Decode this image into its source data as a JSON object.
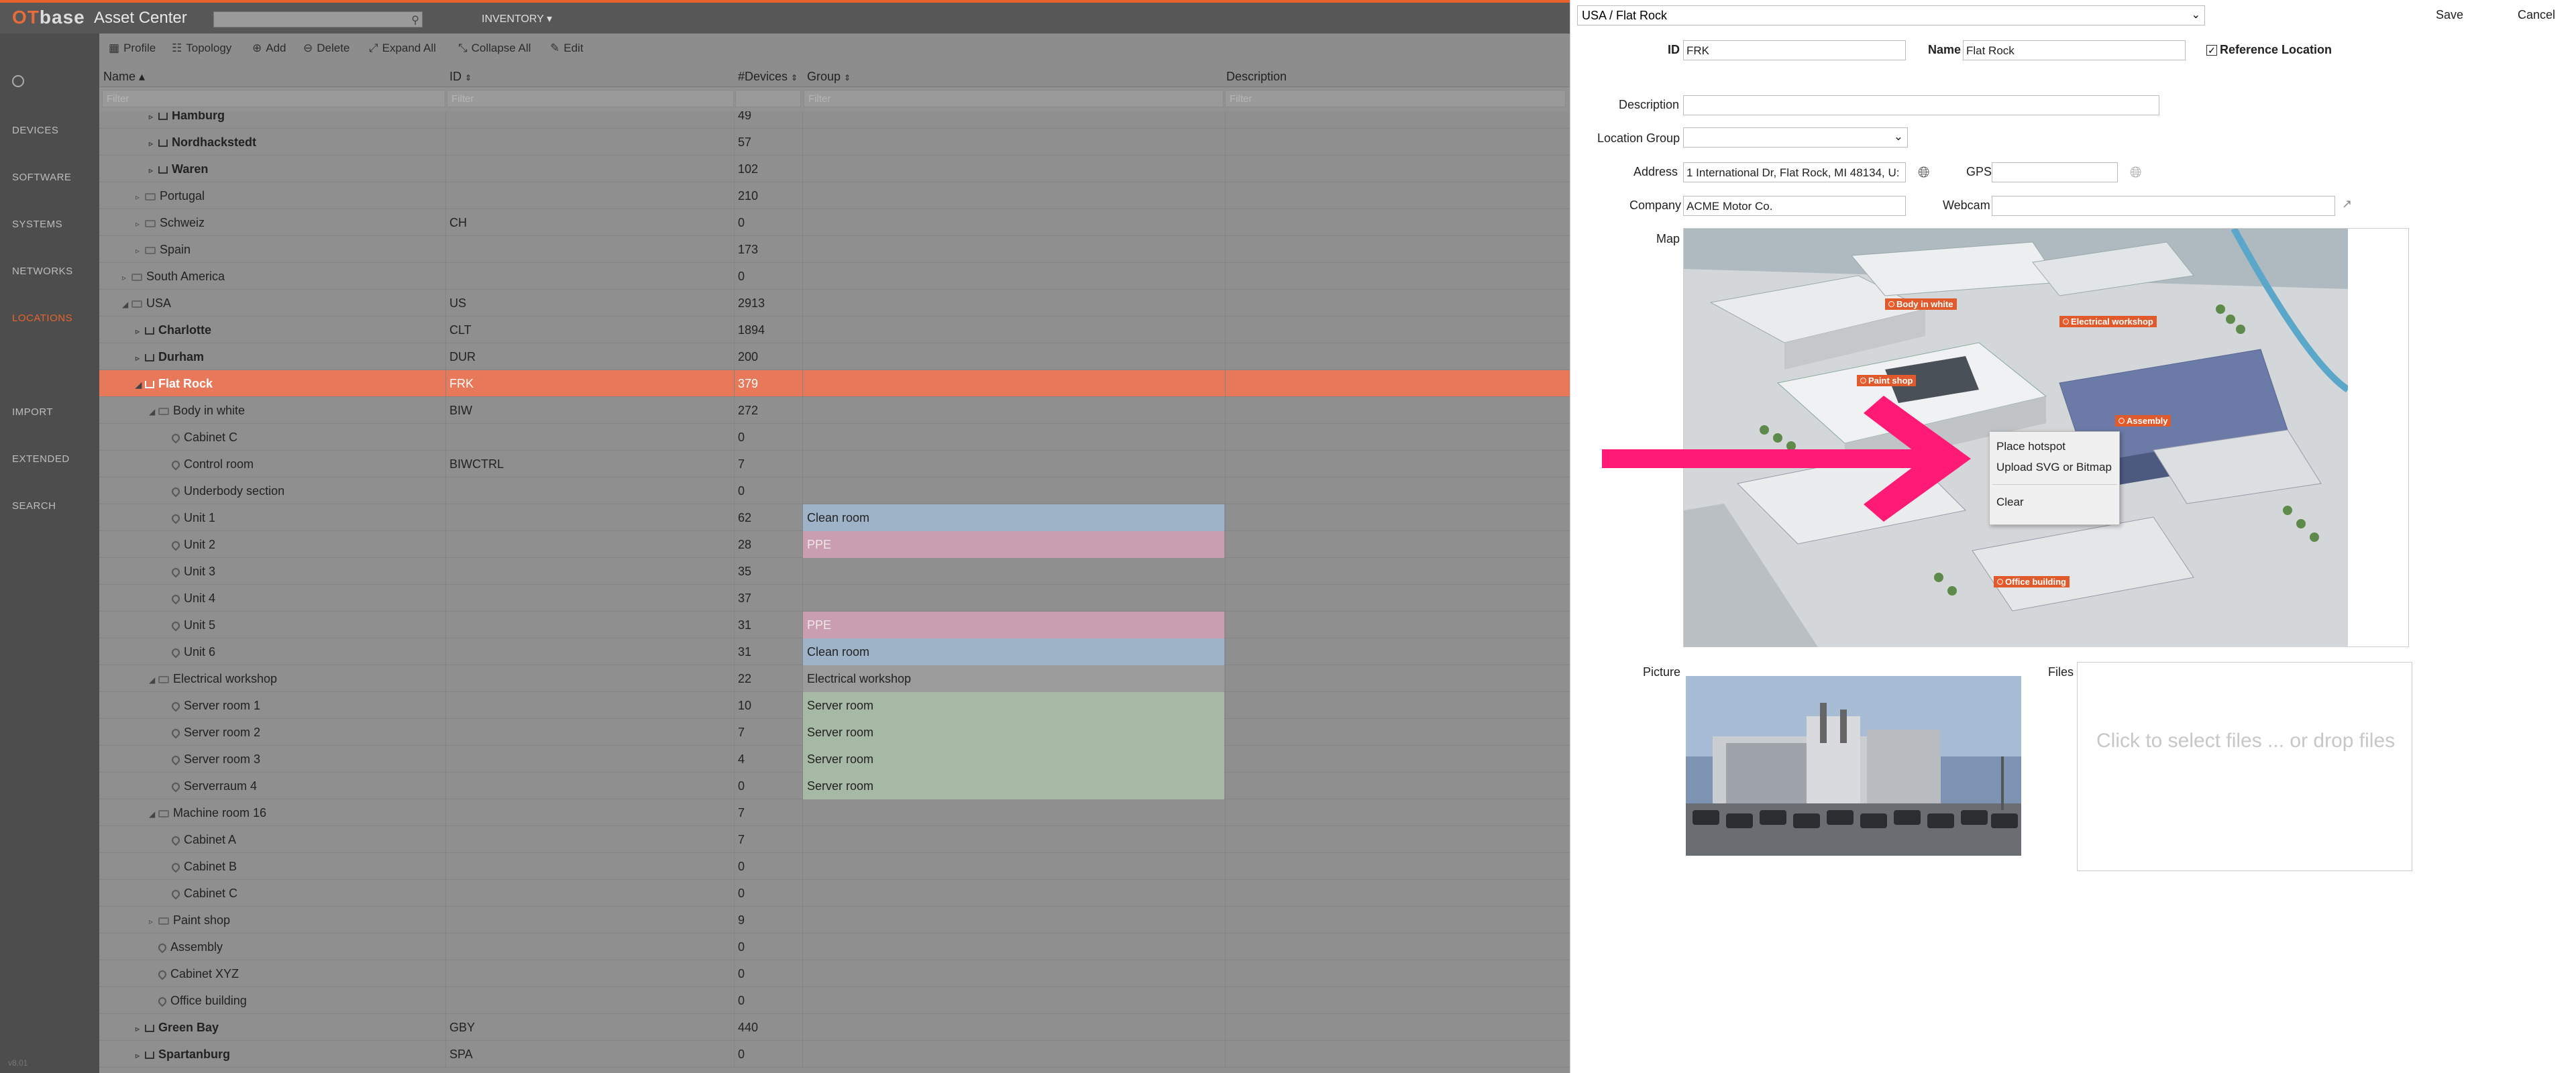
{
  "app": {
    "logo_a": "OT",
    "logo_b": "base",
    "name": "Asset Center",
    "inventory_menu": "INVENTORY",
    "version": "v8.01"
  },
  "nav": [
    "DEVICES",
    "SOFTWARE",
    "SYSTEMS",
    "NETWORKS",
    "LOCATIONS",
    "IMPORT",
    "EXTENDED",
    "SEARCH"
  ],
  "nav_active": "LOCATIONS",
  "toolbar": [
    "Profile",
    "Topology",
    "Add",
    "Delete",
    "Expand All",
    "Collapse All",
    "Edit"
  ],
  "columns": {
    "name": "Name",
    "id": "ID",
    "devices": "#Devices",
    "group": "Group",
    "description": "Description",
    "filter": "Filter"
  },
  "rows": [
    {
      "name": "Hamburg",
      "id": "",
      "devices": "49",
      "group": "",
      "indent": 2,
      "type": "home",
      "bold": true
    },
    {
      "name": "Nordhackstedt",
      "id": "",
      "devices": "57",
      "group": "",
      "indent": 2,
      "type": "home",
      "bold": true
    },
    {
      "name": "Waren",
      "id": "",
      "devices": "102",
      "group": "",
      "indent": 2,
      "type": "home",
      "bold": true
    },
    {
      "name": "Portugal",
      "id": "",
      "devices": "210",
      "group": "",
      "indent": 1,
      "type": "folder"
    },
    {
      "name": "Schweiz",
      "id": "CH",
      "devices": "0",
      "group": "",
      "indent": 1,
      "type": "folder"
    },
    {
      "name": "Spain",
      "id": "",
      "devices": "173",
      "group": "",
      "indent": 1,
      "type": "folder"
    },
    {
      "name": "South America",
      "id": "",
      "devices": "0",
      "group": "",
      "indent": 0,
      "type": "folder"
    },
    {
      "name": "USA",
      "id": "US",
      "devices": "2913",
      "group": "",
      "indent": 0,
      "type": "folder",
      "open": true
    },
    {
      "name": "Charlotte",
      "id": "CLT",
      "devices": "1894",
      "group": "",
      "indent": 1,
      "type": "home",
      "bold": true
    },
    {
      "name": "Durham",
      "id": "DUR",
      "devices": "200",
      "group": "",
      "indent": 1,
      "type": "home",
      "bold": true
    },
    {
      "name": "Flat Rock",
      "id": "FRK",
      "devices": "379",
      "group": "",
      "indent": 1,
      "type": "home",
      "bold": true,
      "selected": true,
      "open": true
    },
    {
      "name": "Body in white",
      "id": "BIW",
      "devices": "272",
      "group": "",
      "indent": 2,
      "type": "folder",
      "open": true
    },
    {
      "name": "Cabinet C",
      "id": "",
      "devices": "0",
      "group": "",
      "indent": 3,
      "type": "pin"
    },
    {
      "name": "Control room",
      "id": "BIWCTRL",
      "devices": "7",
      "group": "",
      "indent": 3,
      "type": "pin"
    },
    {
      "name": "Underbody section",
      "id": "",
      "devices": "0",
      "group": "",
      "indent": 3,
      "type": "pin"
    },
    {
      "name": "Unit 1",
      "id": "",
      "devices": "62",
      "group": "Clean room",
      "gcolor": "#9fb3c8",
      "indent": 3,
      "type": "pin"
    },
    {
      "name": "Unit 2",
      "id": "",
      "devices": "28",
      "group": "PPE",
      "gcolor": "#c99fb0",
      "gtext": "#f0e6ea",
      "indent": 3,
      "type": "pin"
    },
    {
      "name": "Unit 3",
      "id": "",
      "devices": "35",
      "group": "",
      "indent": 3,
      "type": "pin"
    },
    {
      "name": "Unit 4",
      "id": "",
      "devices": "37",
      "group": "",
      "indent": 3,
      "type": "pin"
    },
    {
      "name": "Unit 5",
      "id": "",
      "devices": "31",
      "group": "PPE",
      "gcolor": "#c99fb0",
      "gtext": "#f0e6ea",
      "indent": 3,
      "type": "pin"
    },
    {
      "name": "Unit 6",
      "id": "",
      "devices": "31",
      "group": "Clean room",
      "gcolor": "#9fb3c8",
      "indent": 3,
      "type": "pin"
    },
    {
      "name": "Electrical workshop",
      "id": "",
      "devices": "22",
      "group": "Electrical workshop",
      "gcolor": "#9b9b9b",
      "indent": 2,
      "type": "folder",
      "open": true
    },
    {
      "name": "Server room 1",
      "id": "",
      "devices": "10",
      "group": "Server room",
      "gcolor": "#a6b9a4",
      "indent": 3,
      "type": "pin"
    },
    {
      "name": "Server room 2",
      "id": "",
      "devices": "7",
      "group": "Server room",
      "gcolor": "#a6b9a4",
      "indent": 3,
      "type": "pin"
    },
    {
      "name": "Server room 3",
      "id": "",
      "devices": "4",
      "group": "Server room",
      "gcolor": "#a6b9a4",
      "indent": 3,
      "type": "pin"
    },
    {
      "name": "Serverraum 4",
      "id": "",
      "devices": "0",
      "group": "Server room",
      "gcolor": "#a6b9a4",
      "indent": 3,
      "type": "pin"
    },
    {
      "name": "Machine room 16",
      "id": "",
      "devices": "7",
      "group": "",
      "indent": 2,
      "type": "folder",
      "open": true
    },
    {
      "name": "Cabinet A",
      "id": "",
      "devices": "7",
      "group": "",
      "indent": 3,
      "type": "pin"
    },
    {
      "name": "Cabinet B",
      "id": "",
      "devices": "0",
      "group": "",
      "indent": 3,
      "type": "pin"
    },
    {
      "name": "Cabinet C",
      "id": "",
      "devices": "0",
      "group": "",
      "indent": 3,
      "type": "pin"
    },
    {
      "name": "Paint shop",
      "id": "",
      "devices": "9",
      "group": "",
      "indent": 2,
      "type": "folder"
    },
    {
      "name": "Assembly",
      "id": "",
      "devices": "0",
      "group": "",
      "indent": 2,
      "type": "pin"
    },
    {
      "name": "Cabinet XYZ",
      "id": "",
      "devices": "0",
      "group": "",
      "indent": 2,
      "type": "pin"
    },
    {
      "name": "Office building",
      "id": "",
      "devices": "0",
      "group": "",
      "indent": 2,
      "type": "pin"
    },
    {
      "name": "Green Bay",
      "id": "GBY",
      "devices": "440",
      "group": "",
      "indent": 1,
      "type": "home",
      "bold": true
    },
    {
      "name": "Spartanburg",
      "id": "SPA",
      "devices": "0",
      "group": "",
      "indent": 1,
      "type": "home",
      "bold": true
    }
  ],
  "panel": {
    "path": "USA / Flat Rock",
    "save": "Save",
    "cancel": "Cancel",
    "id_label": "ID",
    "id_value": "FRK",
    "name_label": "Name",
    "name_value": "Flat Rock",
    "reference_label": "Reference Location",
    "description_label": "Description",
    "description_value": "",
    "location_group_label": "Location Group",
    "address_label": "Address",
    "address_value": "1 International Dr, Flat Rock, MI 48134, U:",
    "gps_label": "GPS",
    "gps_value": "",
    "company_label": "Company",
    "company_value": "ACME Motor Co.",
    "webcam_label": "Webcam",
    "webcam_value": "",
    "map_label": "Map",
    "picture_label": "Picture",
    "files_label": "Files",
    "files_placeholder": "Click to select files ... or drop files",
    "hotspots": [
      "Body in white",
      "Electrical workshop",
      "Paint shop",
      "Assembly",
      "Office building"
    ],
    "context_menu": [
      "Place hotspot",
      "Upload SVG or Bitmap",
      "Clear"
    ]
  },
  "colors": {
    "accent": "#e8632b",
    "selected_row": "#e8785a",
    "arrow": "#ff1a75"
  }
}
